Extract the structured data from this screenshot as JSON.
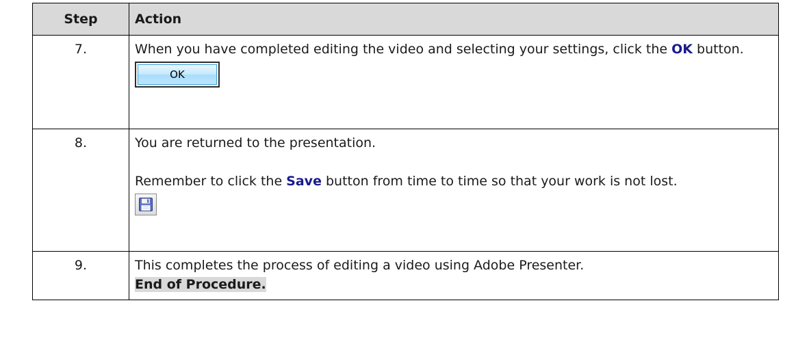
{
  "table": {
    "headers": {
      "step": "Step",
      "action": "Action"
    },
    "rows": [
      {
        "step": "7.",
        "text_before": "When you have completed editing the video and selecting your settings, click the ",
        "keyword": "OK",
        "text_after": " button.",
        "button_label": "OK"
      },
      {
        "step": "8.",
        "line1": "You are returned to the presentation.",
        "text_before": "Remember to click the ",
        "keyword": "Save",
        "text_after": " button from time to time so that your work is not lost.",
        "icon": "floppy-disk-save-icon"
      },
      {
        "step": "9.",
        "line1": "This completes the process of editing a video using Adobe Presenter.",
        "end_label": "End of Procedure."
      }
    ]
  },
  "colors": {
    "header_bg": "#d9d9d9",
    "keyword": "#1a1a8c",
    "ok_button_fill": "#bfe6fd",
    "ok_button_border": "#3aa0d8"
  }
}
